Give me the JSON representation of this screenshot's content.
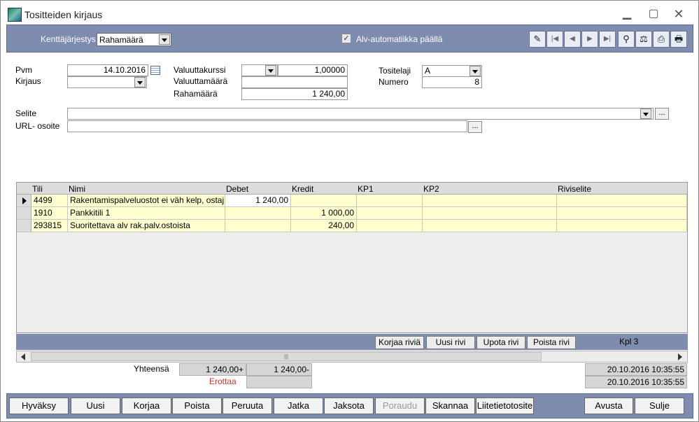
{
  "window": {
    "title": "Tositteiden kirjaus",
    "controls": {
      "minimize": "▁",
      "maximize": "▢",
      "close": "✕"
    }
  },
  "toolbar": {
    "field_order_label": "Kenttäjärjestys",
    "field_order_value": "Rahamäärä",
    "vat_checked": true,
    "vat_check_mark": "✓",
    "vat_label": "Alv-automatiikka päällä",
    "nav_buttons": [
      {
        "icon": "edit-icon",
        "glyph": "✎"
      },
      {
        "icon": "first-record-icon",
        "glyph": "|◀"
      },
      {
        "icon": "prev-record-icon",
        "glyph": "◀"
      },
      {
        "icon": "next-record-icon",
        "glyph": "▶"
      },
      {
        "icon": "last-record-icon",
        "glyph": "▶|"
      },
      {
        "icon": "binoculars-icon",
        "glyph": "⚲"
      },
      {
        "icon": "filter-icon",
        "glyph": "⚖"
      },
      {
        "icon": "preview-icon",
        "glyph": "⎙"
      },
      {
        "icon": "print-icon",
        "glyph": "🖶"
      }
    ]
  },
  "form": {
    "pvm_label": "Pvm",
    "pvm_value": "14.10.2016",
    "kirjaus_label": "Kirjaus",
    "kirjaus_value": "",
    "valuuttakurssi_label": "Valuuttakurssi",
    "valuuttakurssi_currency": "",
    "valuuttakurssi_value": "1,00000",
    "valuuttamaara_label": "Valuuttamäärä",
    "valuuttamaara_value": "",
    "rahamaara_label": "Rahamäärä",
    "rahamaara_value": "1 240,00",
    "tositelaji_label": "Tositelaji",
    "tositelaji_value": "A",
    "numero_label": "Numero",
    "numero_value": "8",
    "selite_label": "Selite",
    "selite_value": "",
    "url_label": "URL- osoite",
    "url_value": "",
    "ellipsis": "..."
  },
  "grid": {
    "columns": [
      "Tili",
      "Nimi",
      "Debet",
      "Kredit",
      "KP1",
      "KP2",
      "Riviselite"
    ],
    "rows": [
      {
        "tili": "4499",
        "nimi": "Rakentamispalveluostot ei väh kelp, ostaj",
        "debet": "1 240,00",
        "kredit": "",
        "kp1": "",
        "kp2": "",
        "riviselite": ""
      },
      {
        "tili": "1910",
        "nimi": "Pankkitili 1",
        "debet": "",
        "kredit": "1 000,00",
        "kp1": "",
        "kp2": "",
        "riviselite": ""
      },
      {
        "tili": "293815",
        "nimi": "Suoritettava alv rak.palv.ostoista",
        "debet": "",
        "kredit": "240,00",
        "kp1": "",
        "kp2": "",
        "riviselite": ""
      }
    ]
  },
  "row_actions": {
    "korjaa": "Korjaa riviä",
    "uusi": "Uusi rivi",
    "upota": "Upota rivi",
    "poista": "Poista rivi",
    "kpl": "Kpl  3"
  },
  "scroll_grip": "|||",
  "totals": {
    "label": "Yhteensä",
    "debet": "1 240,00+",
    "kredit": "1 240,00-",
    "erottaa_label": "Erottaa",
    "erottaa_value": "",
    "timestamp1": "20.10.2016 10:35:55",
    "timestamp2": "20.10.2016 10:35:55"
  },
  "bottom_buttons": {
    "hyvaksy": "Hyväksy",
    "uusi": "Uusi",
    "korjaa": "Korjaa",
    "poista": "Poista",
    "peruuta": "Peruuta",
    "jatka": "Jatka",
    "jaksota": "Jaksota",
    "poraudu": "Poraudu",
    "skannaa": "Skannaa",
    "liitetietotosite": "Liitetietotosite",
    "avusta": "Avusta",
    "sulje": "Sulje"
  },
  "colors": {
    "toolbar_bg": "#7e8cb0",
    "grid_row_bg": "#ffffcf",
    "erottaa_text": "#c0392b"
  }
}
